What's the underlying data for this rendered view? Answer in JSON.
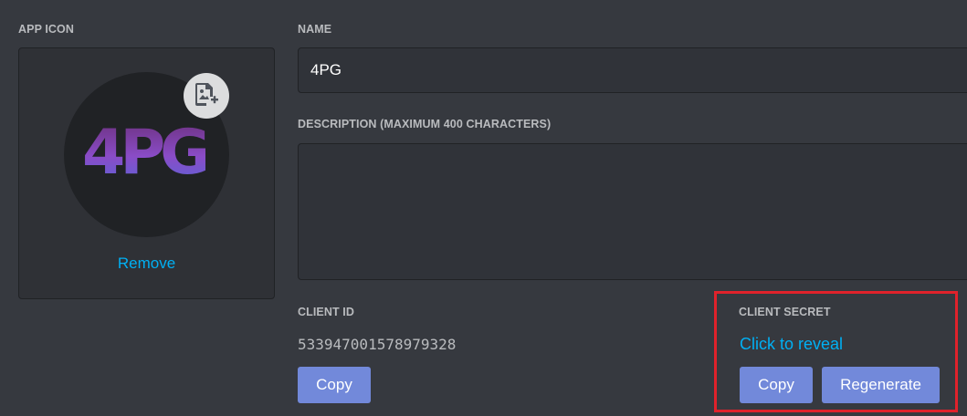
{
  "app_icon": {
    "label": "APP ICON",
    "avatar_text": "4PG",
    "upload_icon": "image-add-icon",
    "remove_label": "Remove"
  },
  "name": {
    "label": "NAME",
    "value": "4PG"
  },
  "description": {
    "label": "DESCRIPTION (MAXIMUM 400 CHARACTERS)",
    "value": ""
  },
  "client_id": {
    "label": "CLIENT ID",
    "value": "533947001578979328",
    "copy_label": "Copy"
  },
  "client_secret": {
    "label": "CLIENT SECRET",
    "reveal_label": "Click to reveal",
    "copy_label": "Copy",
    "regenerate_label": "Regenerate"
  },
  "colors": {
    "background": "#36393f",
    "button": "#7289da",
    "link": "#00b0f4",
    "highlight": "#e0222b"
  }
}
